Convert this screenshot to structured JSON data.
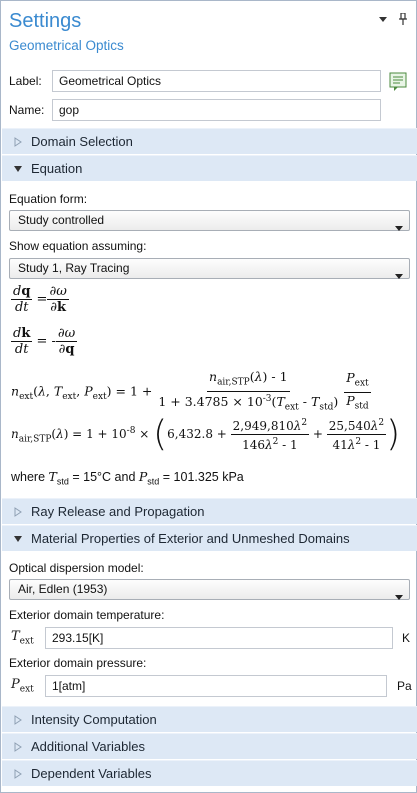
{
  "header": {
    "title": "Settings",
    "subtitle": "Geometrical Optics"
  },
  "label_field": {
    "label": "Label:",
    "value": "Geometrical Optics"
  },
  "name_field": {
    "label": "Name:",
    "value": "gop"
  },
  "sections": {
    "domain_selection": "Domain Selection",
    "equation": "Equation",
    "ray_release": "Ray Release and Propagation",
    "material_props": "Material Properties of Exterior and Unmeshed Domains",
    "intensity": "Intensity Computation",
    "additional_vars": "Additional Variables",
    "dependent_vars": "Dependent Variables"
  },
  "equation": {
    "form_label": "Equation form:",
    "form_value": "Study controlled",
    "assume_label": "Show equation assuming:",
    "assume_value": "Study 1, Ray Tracing",
    "where_text_1": "where ",
    "tstd_eq": " = 15°C and ",
    "pstd_eq": " = 101.325 kPa",
    "coef_1": "1 + 3.4785 × 10",
    "coef_1_exp": "-3",
    "coef_6432": "6,432.8 + ",
    "num_a": "2,949,810",
    "den_a": "146",
    "num_b": "25,540",
    "den_b": "41",
    "one_e8": "1 + 10",
    "e8_exp": "-8"
  },
  "material": {
    "dispersion_label": "Optical dispersion model:",
    "dispersion_value": "Air, Edlen (1953)",
    "temp_label": "Exterior domain temperature:",
    "temp_symbol": "T",
    "temp_sub": "ext",
    "temp_value": "293.15[K]",
    "temp_unit": "K",
    "pres_label": "Exterior domain pressure:",
    "pres_symbol": "P",
    "pres_sub": "ext",
    "pres_value": "1[atm]",
    "pres_unit": "Pa"
  },
  "colors": {
    "accent": "#3a8ad0",
    "section_bg": "#dde8f5"
  }
}
